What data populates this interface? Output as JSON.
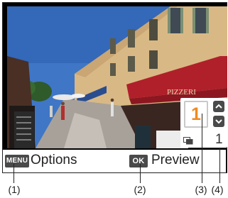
{
  "bottom_bar": {
    "menu_badge": "MENU",
    "menu_label": "Options",
    "ok_badge": "OK",
    "ok_label": "Preview"
  },
  "panel": {
    "current_value": "1",
    "total_value": "1",
    "accent_color": "#f08a1d"
  },
  "icons": [
    "chevron-up-icon",
    "chevron-down-icon",
    "overlap-frames-icon"
  ],
  "callouts": [
    "(1)",
    "(2)",
    "(3)",
    "(4)"
  ]
}
